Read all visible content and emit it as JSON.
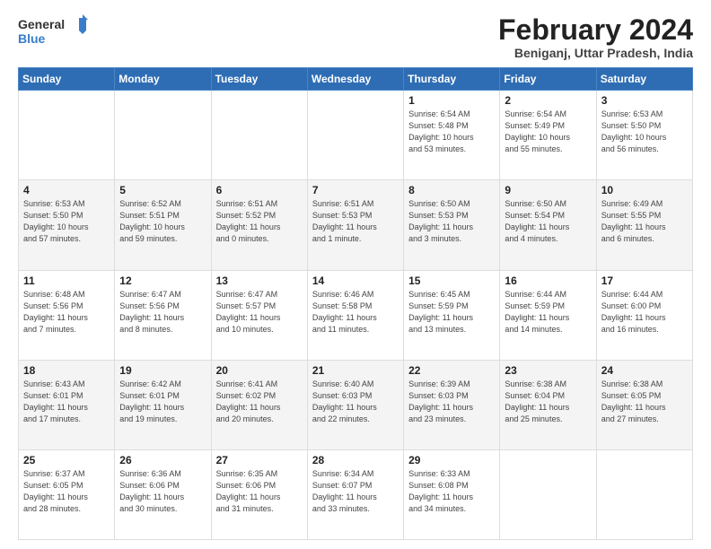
{
  "header": {
    "logo_line1": "General",
    "logo_line2": "Blue",
    "title": "February 2024",
    "subtitle": "Beniganj, Uttar Pradesh, India"
  },
  "calendar": {
    "days_of_week": [
      "Sunday",
      "Monday",
      "Tuesday",
      "Wednesday",
      "Thursday",
      "Friday",
      "Saturday"
    ],
    "weeks": [
      [
        {
          "day": "",
          "info": ""
        },
        {
          "day": "",
          "info": ""
        },
        {
          "day": "",
          "info": ""
        },
        {
          "day": "",
          "info": ""
        },
        {
          "day": "1",
          "info": "Sunrise: 6:54 AM\nSunset: 5:48 PM\nDaylight: 10 hours\nand 53 minutes."
        },
        {
          "day": "2",
          "info": "Sunrise: 6:54 AM\nSunset: 5:49 PM\nDaylight: 10 hours\nand 55 minutes."
        },
        {
          "day": "3",
          "info": "Sunrise: 6:53 AM\nSunset: 5:50 PM\nDaylight: 10 hours\nand 56 minutes."
        }
      ],
      [
        {
          "day": "4",
          "info": "Sunrise: 6:53 AM\nSunset: 5:50 PM\nDaylight: 10 hours\nand 57 minutes."
        },
        {
          "day": "5",
          "info": "Sunrise: 6:52 AM\nSunset: 5:51 PM\nDaylight: 10 hours\nand 59 minutes."
        },
        {
          "day": "6",
          "info": "Sunrise: 6:51 AM\nSunset: 5:52 PM\nDaylight: 11 hours\nand 0 minutes."
        },
        {
          "day": "7",
          "info": "Sunrise: 6:51 AM\nSunset: 5:53 PM\nDaylight: 11 hours\nand 1 minute."
        },
        {
          "day": "8",
          "info": "Sunrise: 6:50 AM\nSunset: 5:53 PM\nDaylight: 11 hours\nand 3 minutes."
        },
        {
          "day": "9",
          "info": "Sunrise: 6:50 AM\nSunset: 5:54 PM\nDaylight: 11 hours\nand 4 minutes."
        },
        {
          "day": "10",
          "info": "Sunrise: 6:49 AM\nSunset: 5:55 PM\nDaylight: 11 hours\nand 6 minutes."
        }
      ],
      [
        {
          "day": "11",
          "info": "Sunrise: 6:48 AM\nSunset: 5:56 PM\nDaylight: 11 hours\nand 7 minutes."
        },
        {
          "day": "12",
          "info": "Sunrise: 6:47 AM\nSunset: 5:56 PM\nDaylight: 11 hours\nand 8 minutes."
        },
        {
          "day": "13",
          "info": "Sunrise: 6:47 AM\nSunset: 5:57 PM\nDaylight: 11 hours\nand 10 minutes."
        },
        {
          "day": "14",
          "info": "Sunrise: 6:46 AM\nSunset: 5:58 PM\nDaylight: 11 hours\nand 11 minutes."
        },
        {
          "day": "15",
          "info": "Sunrise: 6:45 AM\nSunset: 5:59 PM\nDaylight: 11 hours\nand 13 minutes."
        },
        {
          "day": "16",
          "info": "Sunrise: 6:44 AM\nSunset: 5:59 PM\nDaylight: 11 hours\nand 14 minutes."
        },
        {
          "day": "17",
          "info": "Sunrise: 6:44 AM\nSunset: 6:00 PM\nDaylight: 11 hours\nand 16 minutes."
        }
      ],
      [
        {
          "day": "18",
          "info": "Sunrise: 6:43 AM\nSunset: 6:01 PM\nDaylight: 11 hours\nand 17 minutes."
        },
        {
          "day": "19",
          "info": "Sunrise: 6:42 AM\nSunset: 6:01 PM\nDaylight: 11 hours\nand 19 minutes."
        },
        {
          "day": "20",
          "info": "Sunrise: 6:41 AM\nSunset: 6:02 PM\nDaylight: 11 hours\nand 20 minutes."
        },
        {
          "day": "21",
          "info": "Sunrise: 6:40 AM\nSunset: 6:03 PM\nDaylight: 11 hours\nand 22 minutes."
        },
        {
          "day": "22",
          "info": "Sunrise: 6:39 AM\nSunset: 6:03 PM\nDaylight: 11 hours\nand 23 minutes."
        },
        {
          "day": "23",
          "info": "Sunrise: 6:38 AM\nSunset: 6:04 PM\nDaylight: 11 hours\nand 25 minutes."
        },
        {
          "day": "24",
          "info": "Sunrise: 6:38 AM\nSunset: 6:05 PM\nDaylight: 11 hours\nand 27 minutes."
        }
      ],
      [
        {
          "day": "25",
          "info": "Sunrise: 6:37 AM\nSunset: 6:05 PM\nDaylight: 11 hours\nand 28 minutes."
        },
        {
          "day": "26",
          "info": "Sunrise: 6:36 AM\nSunset: 6:06 PM\nDaylight: 11 hours\nand 30 minutes."
        },
        {
          "day": "27",
          "info": "Sunrise: 6:35 AM\nSunset: 6:06 PM\nDaylight: 11 hours\nand 31 minutes."
        },
        {
          "day": "28",
          "info": "Sunrise: 6:34 AM\nSunset: 6:07 PM\nDaylight: 11 hours\nand 33 minutes."
        },
        {
          "day": "29",
          "info": "Sunrise: 6:33 AM\nSunset: 6:08 PM\nDaylight: 11 hours\nand 34 minutes."
        },
        {
          "day": "",
          "info": ""
        },
        {
          "day": "",
          "info": ""
        }
      ]
    ]
  }
}
